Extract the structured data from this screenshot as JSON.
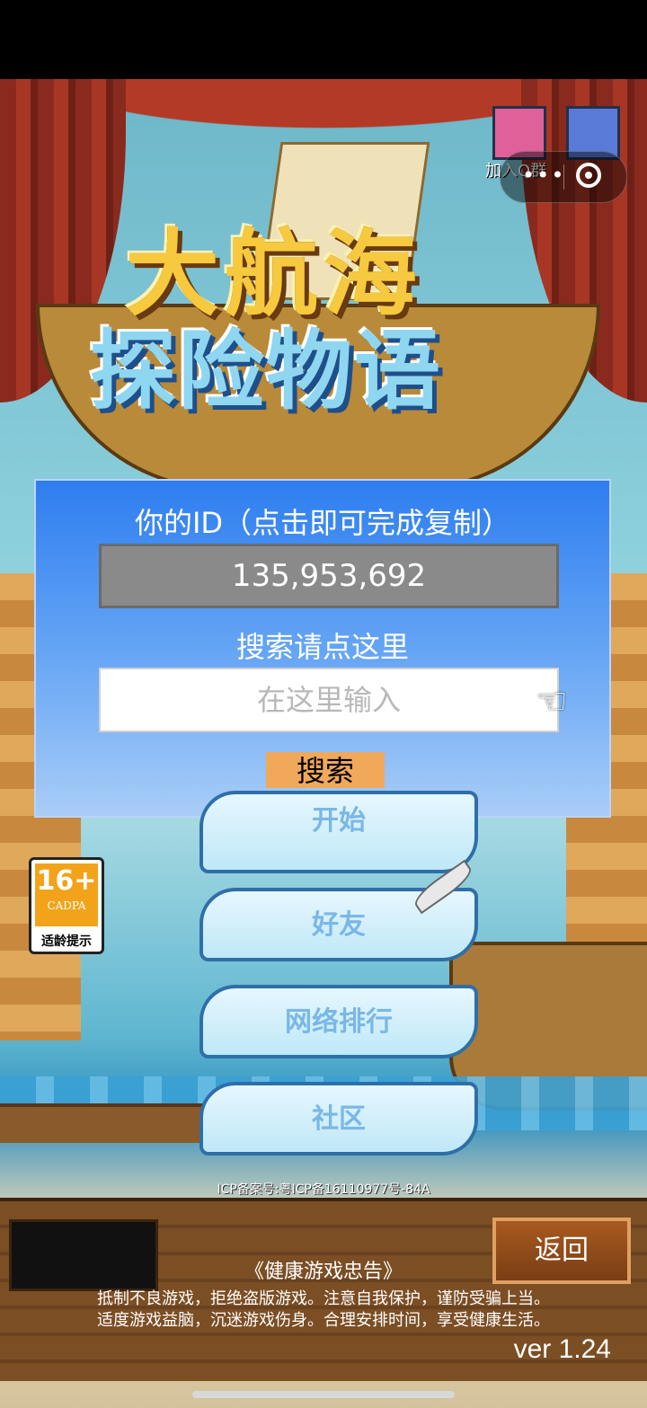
{
  "top_icons": {
    "qq_label": "加入Q群",
    "capsule_dots": "•••"
  },
  "id_panel": {
    "title": "你的ID（点击即可完成复制）",
    "id_value": "135,953,692",
    "search_title": "搜索请点这里",
    "search_placeholder": "在这里输入",
    "search_button": "搜索"
  },
  "logo": {
    "line1": "大航海",
    "line2": "探险物语"
  },
  "menu": {
    "start": "开始",
    "friends": "好友",
    "ranking": "网络排行",
    "community": "社区"
  },
  "age_rating": {
    "number": "16+",
    "org": "CADPA",
    "tip": "适龄提示"
  },
  "icp": "ICP备案号:粤ICP备16110977号-84A",
  "footer": {
    "back_button": "返回",
    "health_title": "《健康游戏忠告》",
    "health_line1": "抵制不良游戏，拒绝盗版游戏。注意自我保护，谨防受骗上当。",
    "health_line2": "适度游戏益脑，沉迷游戏伤身。合理安排时间，享受健康生活。",
    "version": "ver 1.24"
  },
  "colors": {
    "panel_blue": "#2e7ef0",
    "search_button": "#f0a85a",
    "id_box": "#8a8a8a"
  }
}
